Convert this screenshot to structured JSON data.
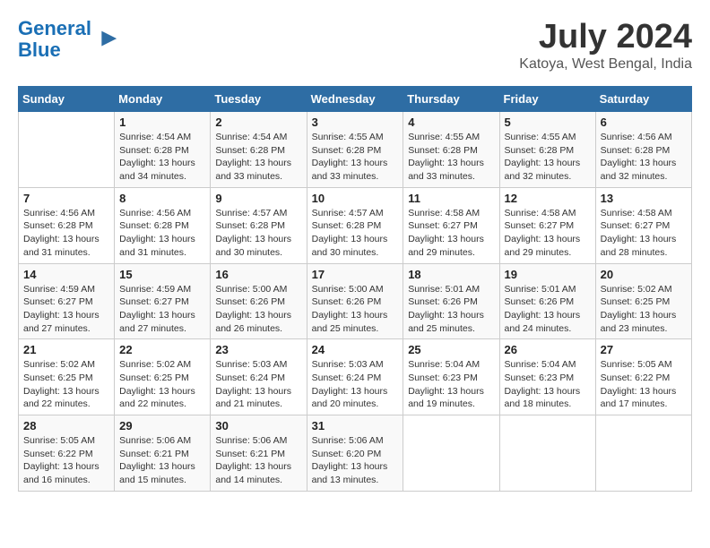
{
  "header": {
    "logo_line1": "General",
    "logo_line2": "Blue",
    "month": "July 2024",
    "location": "Katoya, West Bengal, India"
  },
  "days_of_week": [
    "Sunday",
    "Monday",
    "Tuesday",
    "Wednesday",
    "Thursday",
    "Friday",
    "Saturday"
  ],
  "weeks": [
    [
      {
        "day": "",
        "info": ""
      },
      {
        "day": "1",
        "info": "Sunrise: 4:54 AM\nSunset: 6:28 PM\nDaylight: 13 hours\nand 34 minutes."
      },
      {
        "day": "2",
        "info": "Sunrise: 4:54 AM\nSunset: 6:28 PM\nDaylight: 13 hours\nand 33 minutes."
      },
      {
        "day": "3",
        "info": "Sunrise: 4:55 AM\nSunset: 6:28 PM\nDaylight: 13 hours\nand 33 minutes."
      },
      {
        "day": "4",
        "info": "Sunrise: 4:55 AM\nSunset: 6:28 PM\nDaylight: 13 hours\nand 33 minutes."
      },
      {
        "day": "5",
        "info": "Sunrise: 4:55 AM\nSunset: 6:28 PM\nDaylight: 13 hours\nand 32 minutes."
      },
      {
        "day": "6",
        "info": "Sunrise: 4:56 AM\nSunset: 6:28 PM\nDaylight: 13 hours\nand 32 minutes."
      }
    ],
    [
      {
        "day": "7",
        "info": "Sunrise: 4:56 AM\nSunset: 6:28 PM\nDaylight: 13 hours\nand 31 minutes."
      },
      {
        "day": "8",
        "info": "Sunrise: 4:56 AM\nSunset: 6:28 PM\nDaylight: 13 hours\nand 31 minutes."
      },
      {
        "day": "9",
        "info": "Sunrise: 4:57 AM\nSunset: 6:28 PM\nDaylight: 13 hours\nand 30 minutes."
      },
      {
        "day": "10",
        "info": "Sunrise: 4:57 AM\nSunset: 6:28 PM\nDaylight: 13 hours\nand 30 minutes."
      },
      {
        "day": "11",
        "info": "Sunrise: 4:58 AM\nSunset: 6:27 PM\nDaylight: 13 hours\nand 29 minutes."
      },
      {
        "day": "12",
        "info": "Sunrise: 4:58 AM\nSunset: 6:27 PM\nDaylight: 13 hours\nand 29 minutes."
      },
      {
        "day": "13",
        "info": "Sunrise: 4:58 AM\nSunset: 6:27 PM\nDaylight: 13 hours\nand 28 minutes."
      }
    ],
    [
      {
        "day": "14",
        "info": "Sunrise: 4:59 AM\nSunset: 6:27 PM\nDaylight: 13 hours\nand 27 minutes."
      },
      {
        "day": "15",
        "info": "Sunrise: 4:59 AM\nSunset: 6:27 PM\nDaylight: 13 hours\nand 27 minutes."
      },
      {
        "day": "16",
        "info": "Sunrise: 5:00 AM\nSunset: 6:26 PM\nDaylight: 13 hours\nand 26 minutes."
      },
      {
        "day": "17",
        "info": "Sunrise: 5:00 AM\nSunset: 6:26 PM\nDaylight: 13 hours\nand 25 minutes."
      },
      {
        "day": "18",
        "info": "Sunrise: 5:01 AM\nSunset: 6:26 PM\nDaylight: 13 hours\nand 25 minutes."
      },
      {
        "day": "19",
        "info": "Sunrise: 5:01 AM\nSunset: 6:26 PM\nDaylight: 13 hours\nand 24 minutes."
      },
      {
        "day": "20",
        "info": "Sunrise: 5:02 AM\nSunset: 6:25 PM\nDaylight: 13 hours\nand 23 minutes."
      }
    ],
    [
      {
        "day": "21",
        "info": "Sunrise: 5:02 AM\nSunset: 6:25 PM\nDaylight: 13 hours\nand 22 minutes."
      },
      {
        "day": "22",
        "info": "Sunrise: 5:02 AM\nSunset: 6:25 PM\nDaylight: 13 hours\nand 22 minutes."
      },
      {
        "day": "23",
        "info": "Sunrise: 5:03 AM\nSunset: 6:24 PM\nDaylight: 13 hours\nand 21 minutes."
      },
      {
        "day": "24",
        "info": "Sunrise: 5:03 AM\nSunset: 6:24 PM\nDaylight: 13 hours\nand 20 minutes."
      },
      {
        "day": "25",
        "info": "Sunrise: 5:04 AM\nSunset: 6:23 PM\nDaylight: 13 hours\nand 19 minutes."
      },
      {
        "day": "26",
        "info": "Sunrise: 5:04 AM\nSunset: 6:23 PM\nDaylight: 13 hours\nand 18 minutes."
      },
      {
        "day": "27",
        "info": "Sunrise: 5:05 AM\nSunset: 6:22 PM\nDaylight: 13 hours\nand 17 minutes."
      }
    ],
    [
      {
        "day": "28",
        "info": "Sunrise: 5:05 AM\nSunset: 6:22 PM\nDaylight: 13 hours\nand 16 minutes."
      },
      {
        "day": "29",
        "info": "Sunrise: 5:06 AM\nSunset: 6:21 PM\nDaylight: 13 hours\nand 15 minutes."
      },
      {
        "day": "30",
        "info": "Sunrise: 5:06 AM\nSunset: 6:21 PM\nDaylight: 13 hours\nand 14 minutes."
      },
      {
        "day": "31",
        "info": "Sunrise: 5:06 AM\nSunset: 6:20 PM\nDaylight: 13 hours\nand 13 minutes."
      },
      {
        "day": "",
        "info": ""
      },
      {
        "day": "",
        "info": ""
      },
      {
        "day": "",
        "info": ""
      }
    ]
  ]
}
